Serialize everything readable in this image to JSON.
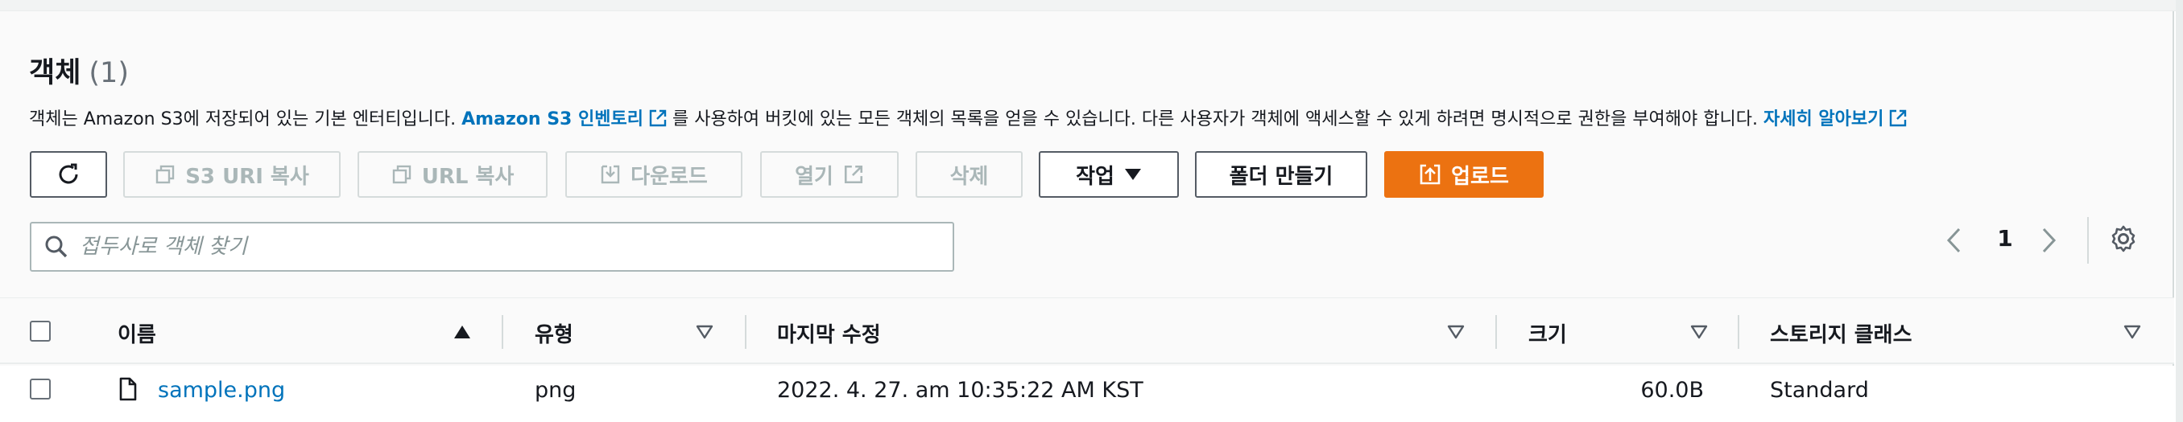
{
  "section": {
    "title": "객체",
    "count": "(1)",
    "description_parts": {
      "prefix": "객체는 Amazon S3에 저장되어 있는 기본 엔터티입니다.",
      "inventory_link": "Amazon S3 인벤토리",
      "middle": "를 사용하여 버킷에 있는 모든 객체의 목록을 얻을 수 있습니다. 다른 사용자가 객체에 액세스할 수 있게 하려면 명시적으로 권한을 부여해야 합니다.",
      "learn_more_link": "자세히 알아보기"
    }
  },
  "toolbar": {
    "refresh_icon": "refresh-icon",
    "copy_s3_uri": "S3 URI 복사",
    "copy_url": "URL 복사",
    "download": "다운로드",
    "open": "열기",
    "delete": "삭제",
    "actions": "작업",
    "create_folder": "폴더 만들기",
    "upload": "업로드"
  },
  "search": {
    "placeholder": "접두사로 객체 찾기",
    "value": ""
  },
  "pagination": {
    "current_page": "1"
  },
  "table": {
    "columns": [
      "이름",
      "유형",
      "마지막 수정",
      "크기",
      "스토리지 클래스"
    ],
    "rows": [
      {
        "name": "sample.png",
        "type": "png",
        "last_modified": "2022. 4. 27. am 10:35:22 AM KST",
        "size": "60.0B",
        "storage_class": "Standard"
      }
    ]
  },
  "colors": {
    "accent": "#ec7211",
    "link": "#0073bb",
    "disabled": "#aab7b8",
    "text": "#16191f"
  }
}
